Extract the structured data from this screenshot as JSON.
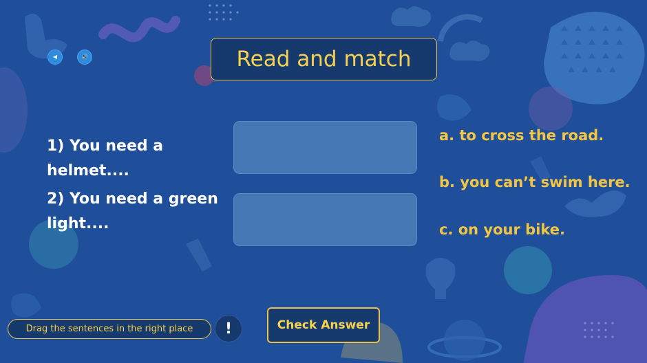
{
  "controls": {
    "back_glyph": "◀",
    "back_icon": "play-back-icon",
    "sound_glyph": "🔊",
    "sound_icon": "speaker-icon"
  },
  "title": "Read and match",
  "prompts": [
    {
      "text": "1) You need a helmet...."
    },
    {
      "text": "2) You need a green light...."
    }
  ],
  "answers": [
    {
      "text": "a. to cross the road."
    },
    {
      "text": "b. you can’t swim here."
    },
    {
      "text": "c. on your bike."
    }
  ],
  "footer": {
    "hint": "Drag the sentences in the right place",
    "info_glyph": "!",
    "info_icon": "exclamation-icon",
    "check_label": "Check Answer"
  },
  "colors": {
    "background": "#1f4f9a",
    "panel": "#173a6e",
    "accent_gold": "#f6d24f",
    "drop_zone": "#4677b5",
    "button_blue": "#2e8be0"
  }
}
